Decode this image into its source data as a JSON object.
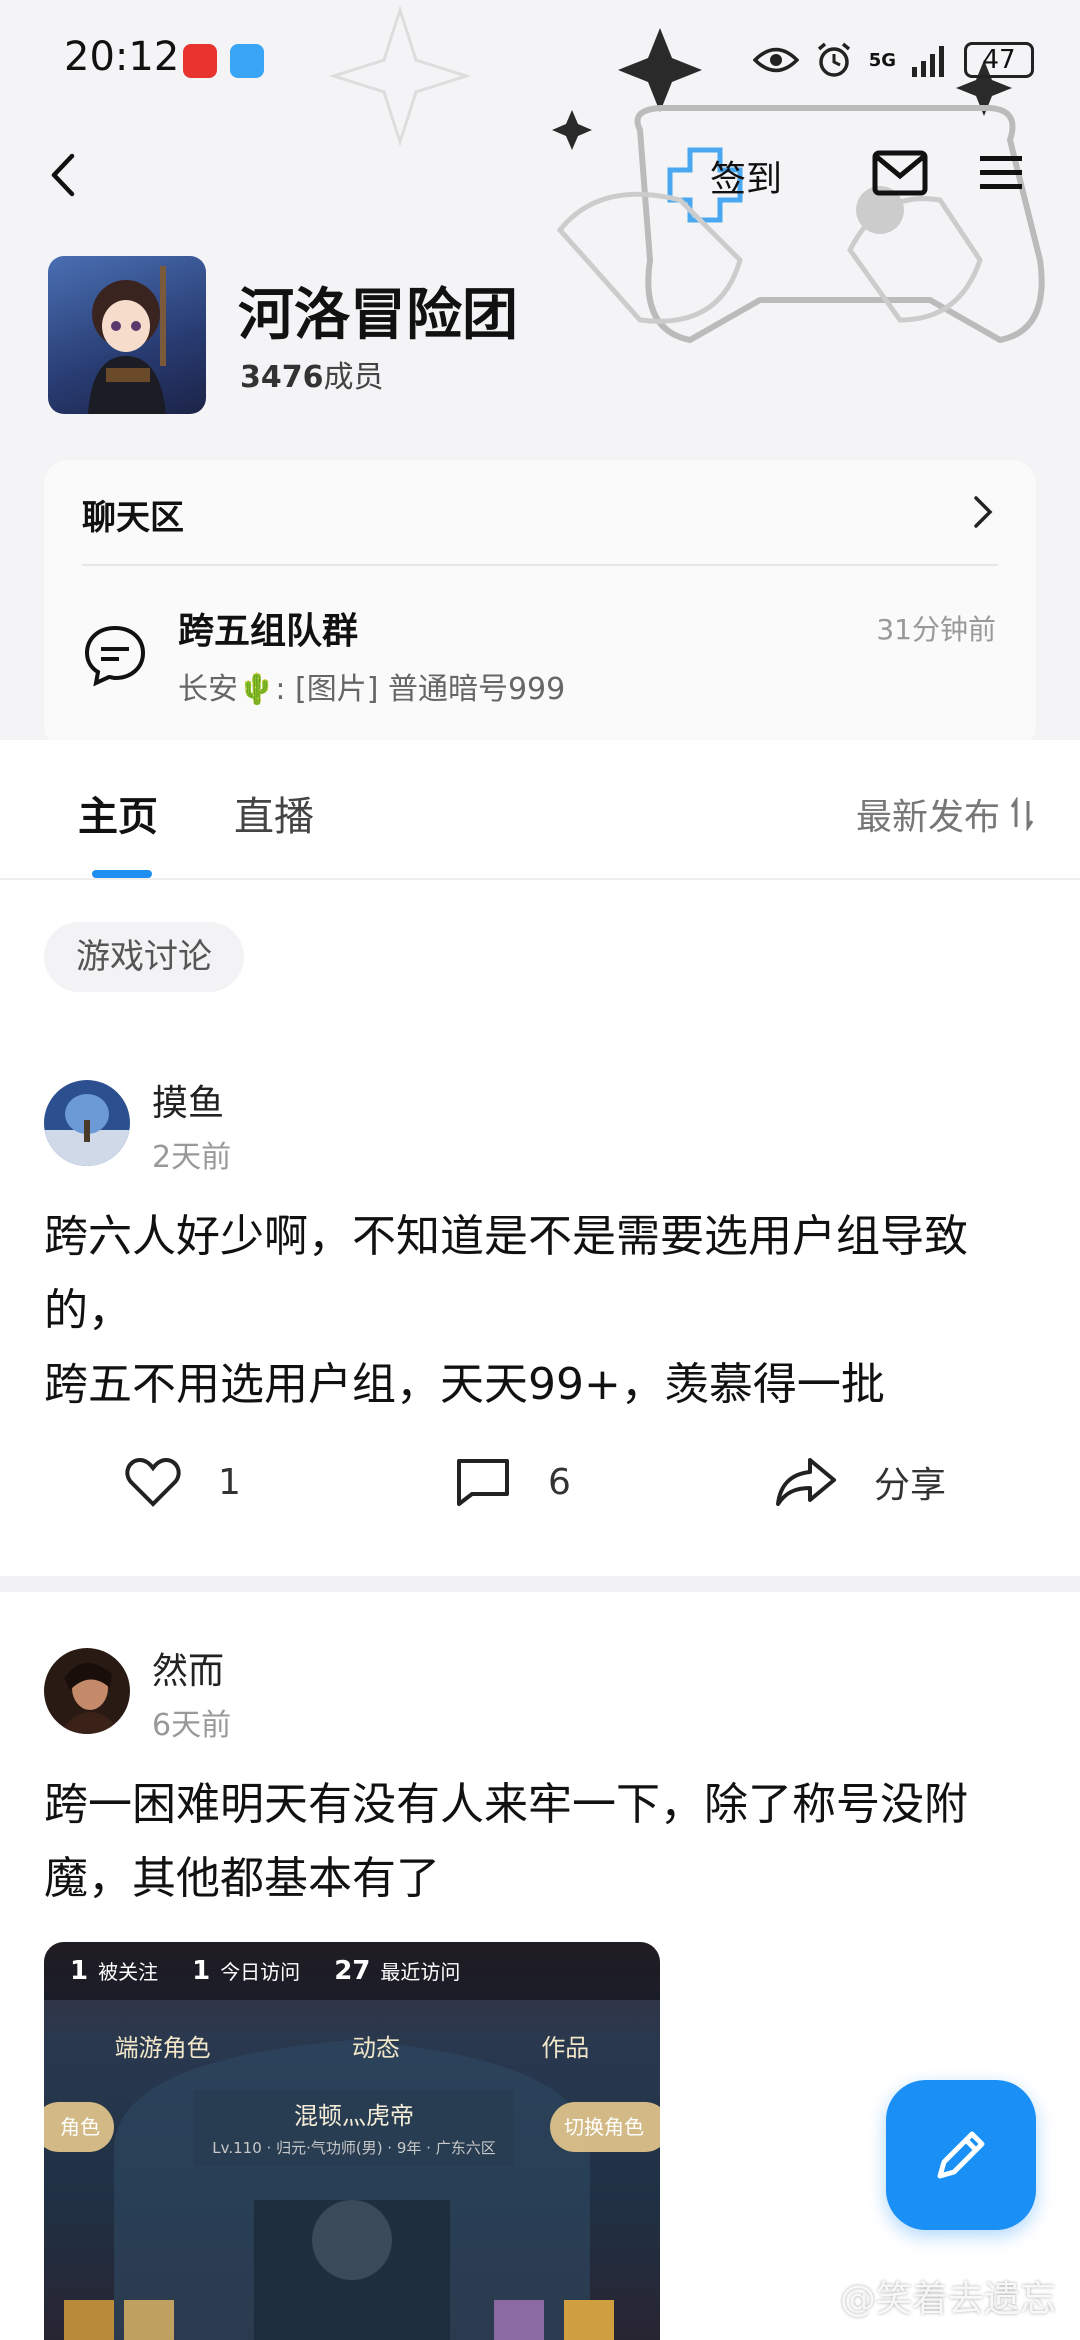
{
  "status_bar": {
    "time": "20:12",
    "signal": "5G",
    "battery": "47"
  },
  "nav": {
    "checkin_label": "签到"
  },
  "group": {
    "name": "河洛冒险团",
    "member_count": "3476",
    "member_suffix": "成员"
  },
  "chat_section": {
    "title": "聊天区",
    "item": {
      "name": "跨五组队群",
      "preview": "长安🌵: [图片] 普通暗号999",
      "time": "31分钟前"
    }
  },
  "tabs": {
    "home": "主页",
    "live": "直播",
    "sort_label": "最新发布"
  },
  "tag": "游戏讨论",
  "posts": [
    {
      "author": "摸鱼",
      "time": "2天前",
      "text": "跨六人好少啊，不知道是不是需要选用户组导致的，\n跨五不用选用户组，天天99+，羡慕得一批",
      "likes": "1",
      "comments": "6",
      "share_label": "分享"
    },
    {
      "author": "然而",
      "time": "6天前",
      "text": "跨一困难明天有没有人来牢一下，除了称号没附魔，其他都基本有了",
      "image": {
        "followers_count": "1",
        "followers_label": "被关注",
        "visits_today_count": "1",
        "visits_today_label": "今日访问",
        "recent_visits_count": "27",
        "recent_visits_label": "最近访问",
        "tab1": "端游角色",
        "tab2": "动态",
        "tab3": "作品",
        "role_button": "角色",
        "switch_button": "切换角色",
        "character_name": "混顿灬虎帝",
        "character_info": "Lv.110 · 归元·气功师(男) · 9年 · 广东六区"
      }
    }
  ],
  "watermark": "@笑着去遗忘",
  "colors": {
    "accent": "#1e8ef0",
    "fab": "#1a8ff5"
  }
}
